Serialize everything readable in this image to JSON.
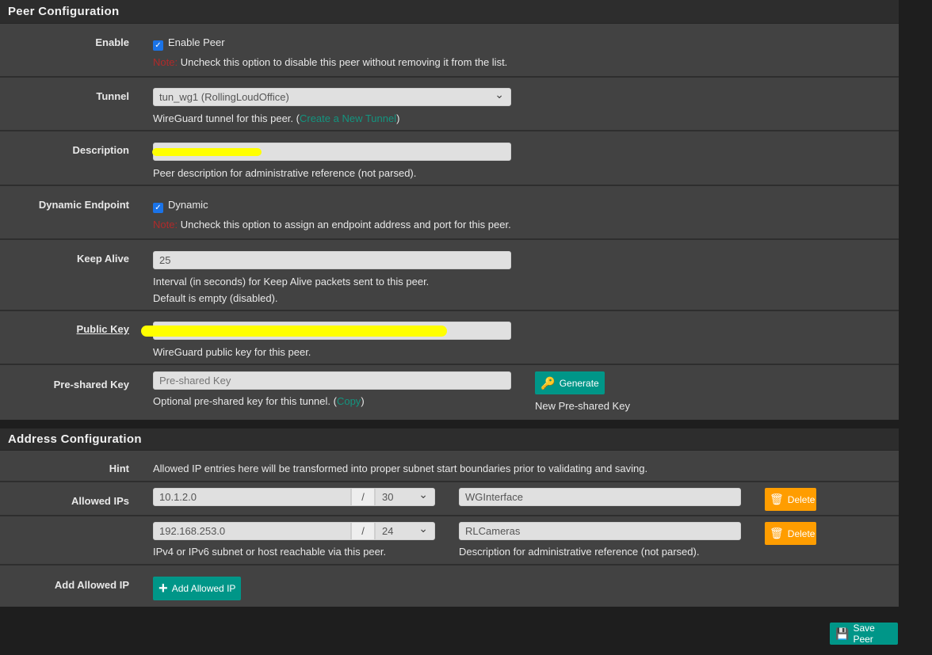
{
  "peer": {
    "title": "Peer Configuration",
    "enable": {
      "label": "Enable",
      "checkbox_label": "Enable Peer",
      "checked": true,
      "note": "Note:",
      "help": "Uncheck this option to disable this peer without removing it from the list."
    },
    "tunnel": {
      "label": "Tunnel",
      "value": "tun_wg1 (RollingLoudOffice)",
      "help": "WireGuard tunnel for this peer. (",
      "link": "Create a New Tunnel",
      "help_end": ")"
    },
    "description": {
      "label": "Description",
      "help": "Peer description for administrative reference (not parsed)."
    },
    "dynamic": {
      "label": "Dynamic Endpoint",
      "checkbox_label": "Dynamic",
      "checked": true,
      "note": "Note:",
      "help": "Uncheck this option to assign an endpoint address and port for this peer."
    },
    "keepalive": {
      "label": "Keep Alive",
      "value": "25",
      "help1": "Interval (in seconds) for Keep Alive packets sent to this peer.",
      "help2": "Default is empty (disabled)."
    },
    "public_key": {
      "label": "Public Key",
      "help": "WireGuard public key for this peer."
    },
    "psk": {
      "label": "Pre-shared Key",
      "placeholder": "Pre-shared Key",
      "help": "Optional pre-shared key for this tunnel. (",
      "link": "Copy",
      "help_end": ")",
      "generate": "Generate",
      "generate_help": "New Pre-shared Key"
    }
  },
  "address": {
    "title": "Address Configuration",
    "hint_label": "Hint",
    "hint": "Allowed IP entries here will be transformed into proper subnet start boundaries prior to validating and saving.",
    "allowed_label": "Allowed IPs",
    "sep": "/",
    "entries": [
      {
        "ip": "10.1.2.0",
        "mask": "30",
        "desc": "WGInterface"
      },
      {
        "ip": "192.168.253.0",
        "mask": "24",
        "desc": "RLCameras"
      }
    ],
    "delete": "Delete",
    "ip_help": "IPv4 or IPv6 subnet or host reachable via this peer.",
    "desc_help": "Description for administrative reference (not parsed).",
    "add_label": "Add Allowed IP",
    "add_button": "Add Allowed IP"
  },
  "save": "Save Peer",
  "colors": {
    "accent": "#009688",
    "delete": "#ff9d00",
    "note": "#b02a2a"
  }
}
